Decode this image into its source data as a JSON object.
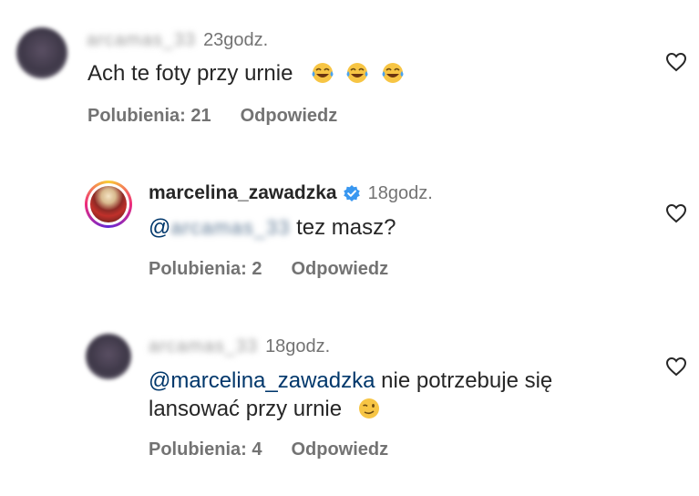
{
  "comments": [
    {
      "username_blurred": "arcamas_33",
      "time": "23godz.",
      "text": "Ach te foty przy urnie",
      "emoji": [
        "tears-of-joy-emoji",
        "tears-of-joy-emoji",
        "tears-of-joy-emoji"
      ],
      "likes_label": "Polubienia: 21",
      "reply_label": "Odpowiedz"
    },
    {
      "username": "marcelina_zawadzka",
      "verified": true,
      "time": "18godz.",
      "mention_prefix": "@",
      "mention_blurred": "arcamas_33",
      "text": "tez masz?",
      "likes_label": "Polubienia: 2",
      "reply_label": "Odpowiedz"
    },
    {
      "username_blurred": "arcamas_33",
      "time": "18godz.",
      "mention": "@marcelina_zawadzka",
      "text_line1": "nie potrzebuje się",
      "text_line2": "lansować przy urnie",
      "emoji": [
        "winking-face-emoji"
      ],
      "likes_label": "Polubienia: 4",
      "reply_label": "Odpowiedz"
    }
  ],
  "colors": {
    "text": "#262626",
    "secondary": "#737373",
    "mention": "#00376b",
    "verified": "#3897f0"
  }
}
